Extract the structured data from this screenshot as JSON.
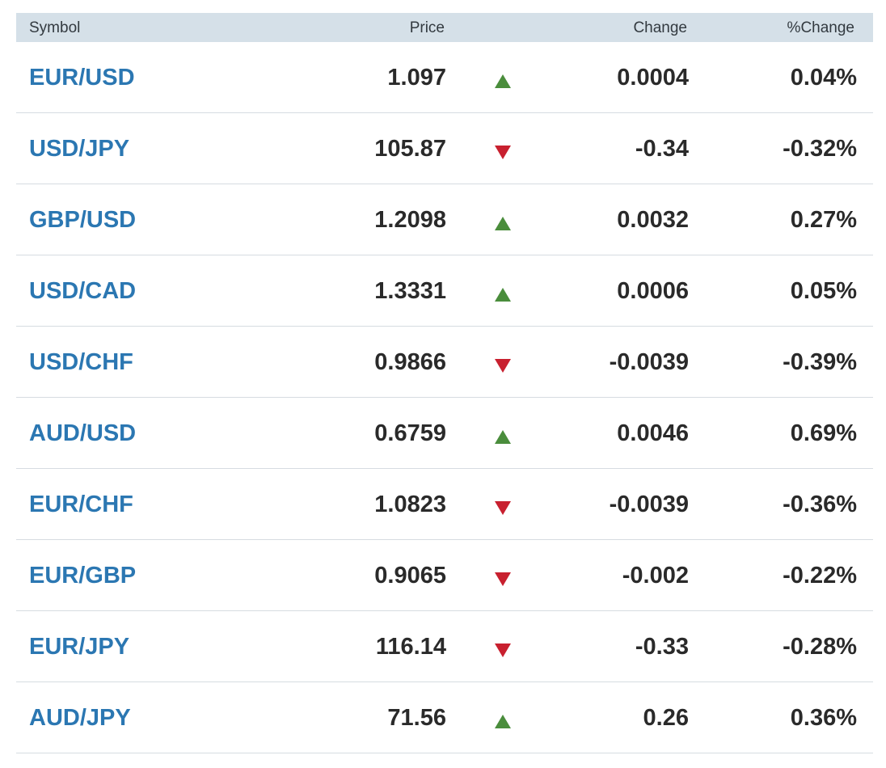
{
  "table": {
    "headers": {
      "symbol": "Symbol",
      "price": "Price",
      "change": "Change",
      "pct_change": "%Change"
    },
    "colors": {
      "header_bg": "#d5e0e8",
      "symbol_link": "#2b77b2",
      "up": "#4a8d3c",
      "down": "#c8202f"
    },
    "rows": [
      {
        "symbol": "EUR/USD",
        "price": "1.097",
        "direction": "up",
        "icon": "up-arrow-icon",
        "change": "0.0004",
        "pct_change": "0.04%"
      },
      {
        "symbol": "USD/JPY",
        "price": "105.87",
        "direction": "down",
        "icon": "down-arrow-icon",
        "change": "-0.34",
        "pct_change": "-0.32%"
      },
      {
        "symbol": "GBP/USD",
        "price": "1.2098",
        "direction": "up",
        "icon": "up-arrow-icon",
        "change": "0.0032",
        "pct_change": "0.27%"
      },
      {
        "symbol": "USD/CAD",
        "price": "1.3331",
        "direction": "up",
        "icon": "up-arrow-icon",
        "change": "0.0006",
        "pct_change": "0.05%"
      },
      {
        "symbol": "USD/CHF",
        "price": "0.9866",
        "direction": "down",
        "icon": "down-arrow-icon",
        "change": "-0.0039",
        "pct_change": "-0.39%"
      },
      {
        "symbol": "AUD/USD",
        "price": "0.6759",
        "direction": "up",
        "icon": "up-arrow-icon",
        "change": "0.0046",
        "pct_change": "0.69%"
      },
      {
        "symbol": "EUR/CHF",
        "price": "1.0823",
        "direction": "down",
        "icon": "down-arrow-icon",
        "change": "-0.0039",
        "pct_change": "-0.36%"
      },
      {
        "symbol": "EUR/GBP",
        "price": "0.9065",
        "direction": "down",
        "icon": "down-arrow-icon",
        "change": "-0.002",
        "pct_change": "-0.22%"
      },
      {
        "symbol": "EUR/JPY",
        "price": "116.14",
        "direction": "down",
        "icon": "down-arrow-icon",
        "change": "-0.33",
        "pct_change": "-0.28%"
      },
      {
        "symbol": "AUD/JPY",
        "price": "71.56",
        "direction": "up",
        "icon": "up-arrow-icon",
        "change": "0.26",
        "pct_change": "0.36%"
      }
    ]
  }
}
